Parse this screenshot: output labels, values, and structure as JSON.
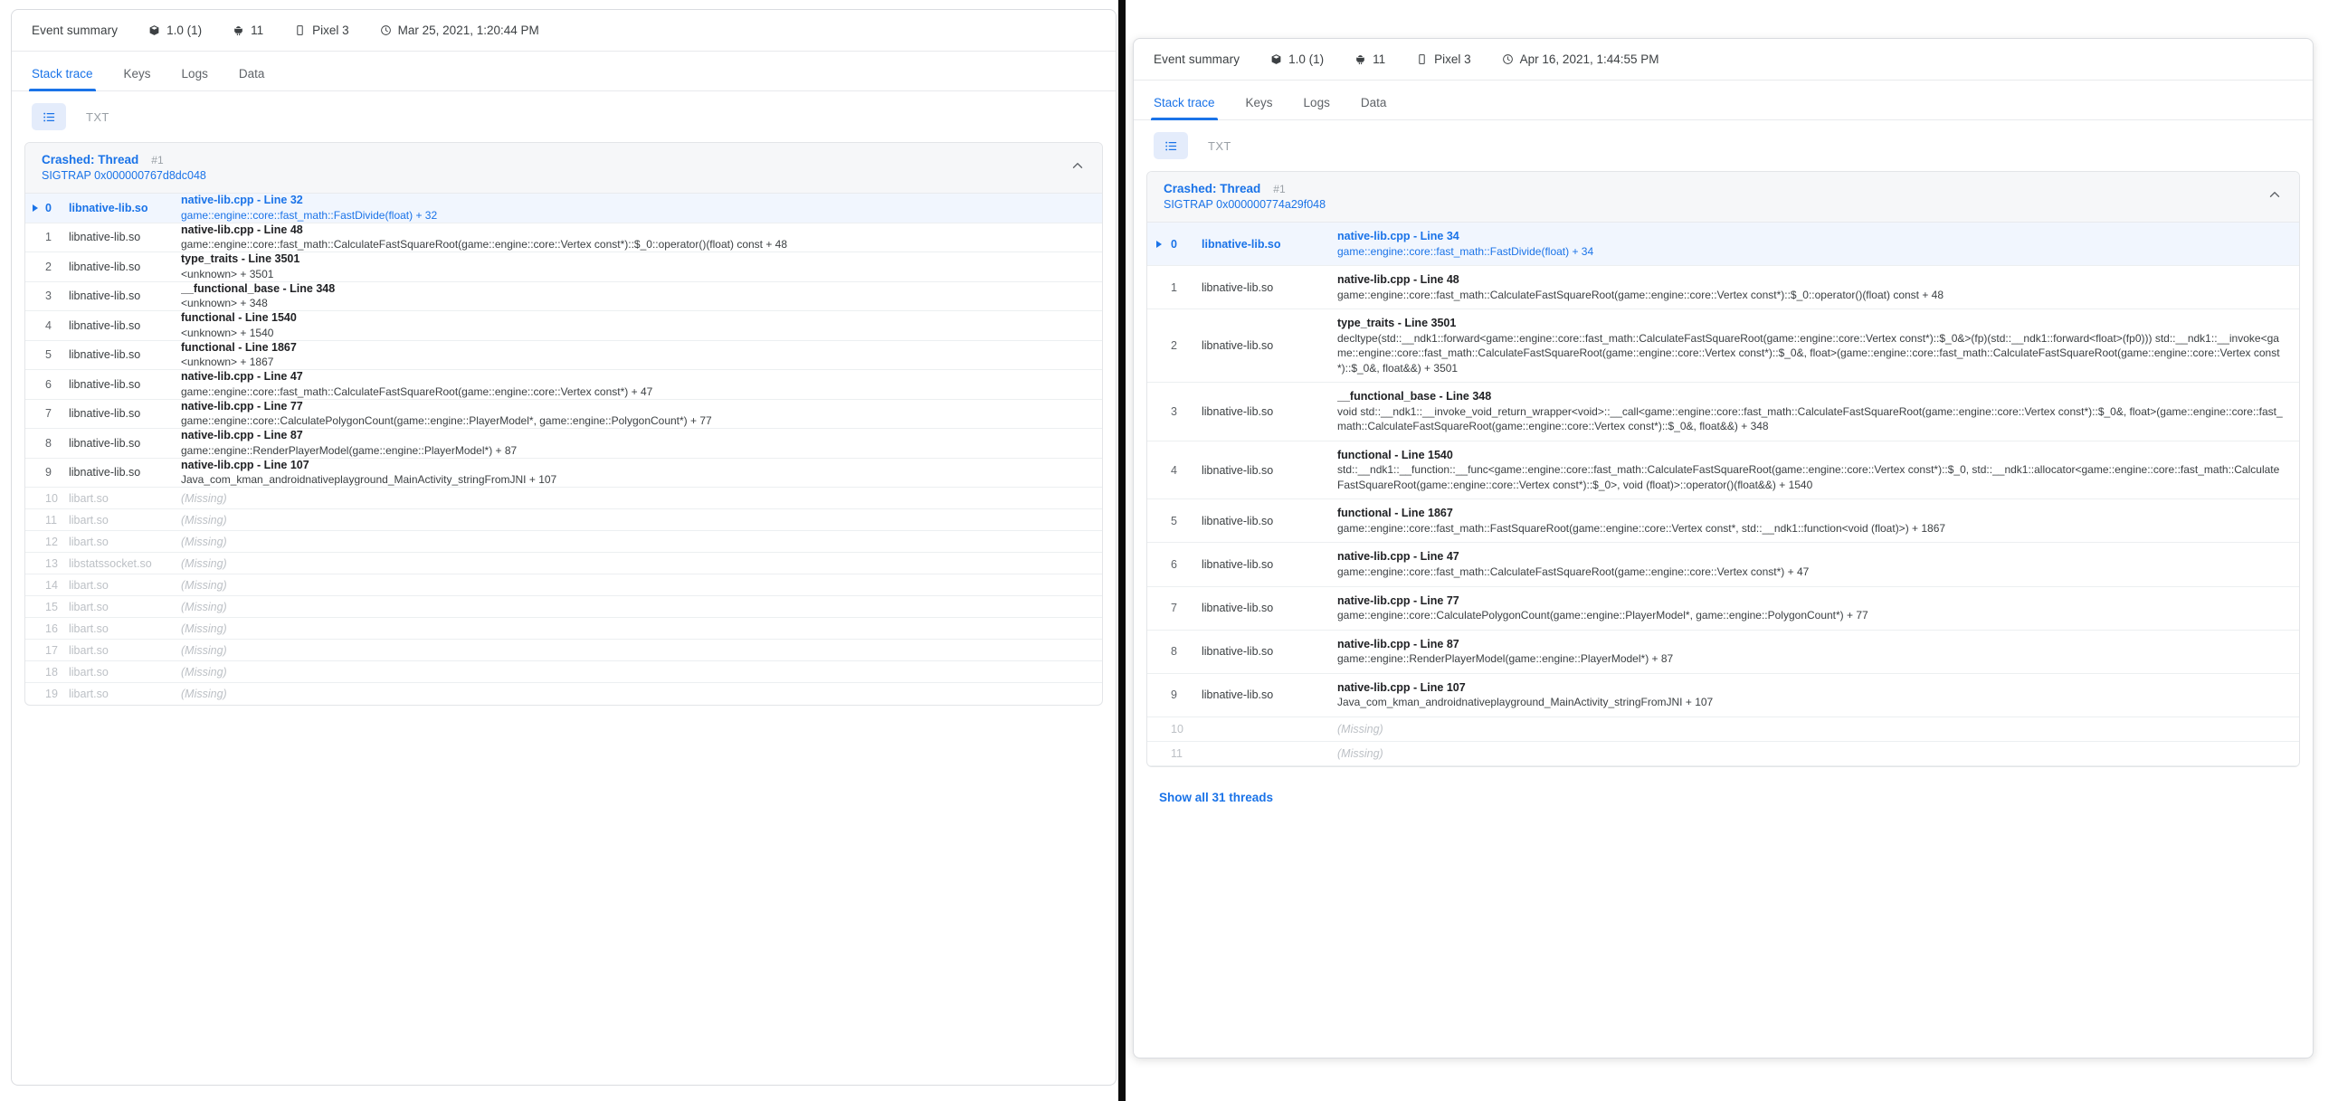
{
  "panels": {
    "left": {
      "summary": {
        "label": "Event summary",
        "version": "1.0 (1)",
        "api_level": "11",
        "device": "Pixel 3",
        "timestamp": "Mar 25, 2021, 1:20:44 PM"
      },
      "tabs": [
        {
          "label": "Stack trace",
          "active": true
        },
        {
          "label": "Keys",
          "active": false
        },
        {
          "label": "Logs",
          "active": false
        },
        {
          "label": "Data",
          "active": false
        }
      ],
      "view": {
        "list_icon": "list-view-icon",
        "txt_label": "TXT"
      },
      "thread": {
        "title": "Crashed: Thread",
        "number": "#1",
        "signal": "SIGTRAP 0x000000767d8dc048",
        "collapse_icon": "chevron-up-icon"
      },
      "frames": [
        {
          "index": "0",
          "lib": "libnative-lib.so",
          "line": "native-lib.cpp - Line 32",
          "symbol": "game::engine::core::fast_math::FastDivide(float) + 32",
          "crash": true,
          "missing": false
        },
        {
          "index": "1",
          "lib": "libnative-lib.so",
          "line": "native-lib.cpp - Line 48",
          "symbol": "game::engine::core::fast_math::CalculateFastSquareRoot(game::engine::core::Vertex const*)::$_0::operator()(float) const + 48",
          "crash": false,
          "missing": false
        },
        {
          "index": "2",
          "lib": "libnative-lib.so",
          "line": "type_traits - Line 3501",
          "symbol": "<unknown> + 3501",
          "crash": false,
          "missing": false
        },
        {
          "index": "3",
          "lib": "libnative-lib.so",
          "line": "__functional_base - Line 348",
          "symbol": "<unknown> + 348",
          "crash": false,
          "missing": false
        },
        {
          "index": "4",
          "lib": "libnative-lib.so",
          "line": "functional - Line 1540",
          "symbol": "<unknown> + 1540",
          "crash": false,
          "missing": false
        },
        {
          "index": "5",
          "lib": "libnative-lib.so",
          "line": "functional - Line 1867",
          "symbol": "<unknown> + 1867",
          "crash": false,
          "missing": false
        },
        {
          "index": "6",
          "lib": "libnative-lib.so",
          "line": "native-lib.cpp - Line 47",
          "symbol": "game::engine::core::fast_math::CalculateFastSquareRoot(game::engine::core::Vertex const*) + 47",
          "crash": false,
          "missing": false
        },
        {
          "index": "7",
          "lib": "libnative-lib.so",
          "line": "native-lib.cpp - Line 77",
          "symbol": "game::engine::core::CalculatePolygonCount(game::engine::PlayerModel*, game::engine::PolygonCount*) + 77",
          "crash": false,
          "missing": false
        },
        {
          "index": "8",
          "lib": "libnative-lib.so",
          "line": "native-lib.cpp - Line 87",
          "symbol": "game::engine::RenderPlayerModel(game::engine::PlayerModel*) + 87",
          "crash": false,
          "missing": false
        },
        {
          "index": "9",
          "lib": "libnative-lib.so",
          "line": "native-lib.cpp - Line 107",
          "symbol": "Java_com_kman_androidnativeplayground_MainActivity_stringFromJNI + 107",
          "crash": false,
          "missing": false
        },
        {
          "index": "10",
          "lib": "libart.so",
          "line": "",
          "symbol": "",
          "missing_label": "(Missing)",
          "crash": false,
          "missing": true
        },
        {
          "index": "11",
          "lib": "libart.so",
          "line": "",
          "symbol": "",
          "missing_label": "(Missing)",
          "crash": false,
          "missing": true
        },
        {
          "index": "12",
          "lib": "libart.so",
          "line": "",
          "symbol": "",
          "missing_label": "(Missing)",
          "crash": false,
          "missing": true
        },
        {
          "index": "13",
          "lib": "libstatssocket.so",
          "line": "",
          "symbol": "",
          "missing_label": "(Missing)",
          "crash": false,
          "missing": true
        },
        {
          "index": "14",
          "lib": "libart.so",
          "line": "",
          "symbol": "",
          "missing_label": "(Missing)",
          "crash": false,
          "missing": true
        },
        {
          "index": "15",
          "lib": "libart.so",
          "line": "",
          "symbol": "",
          "missing_label": "(Missing)",
          "crash": false,
          "missing": true
        },
        {
          "index": "16",
          "lib": "libart.so",
          "line": "",
          "symbol": "",
          "missing_label": "(Missing)",
          "crash": false,
          "missing": true
        },
        {
          "index": "17",
          "lib": "libart.so",
          "line": "",
          "symbol": "",
          "missing_label": "(Missing)",
          "crash": false,
          "missing": true
        },
        {
          "index": "18",
          "lib": "libart.so",
          "line": "",
          "symbol": "",
          "missing_label": "(Missing)",
          "crash": false,
          "missing": true
        },
        {
          "index": "19",
          "lib": "libart.so",
          "line": "",
          "symbol": "",
          "missing_label": "(Missing)",
          "crash": false,
          "missing": true
        }
      ]
    },
    "right": {
      "summary": {
        "label": "Event summary",
        "version": "1.0 (1)",
        "api_level": "11",
        "device": "Pixel 3",
        "timestamp": "Apr 16, 2021, 1:44:55 PM"
      },
      "tabs": [
        {
          "label": "Stack trace",
          "active": true
        },
        {
          "label": "Keys",
          "active": false
        },
        {
          "label": "Logs",
          "active": false
        },
        {
          "label": "Data",
          "active": false
        }
      ],
      "view": {
        "list_icon": "list-view-icon",
        "txt_label": "TXT"
      },
      "thread": {
        "title": "Crashed: Thread",
        "number": "#1",
        "signal": "SIGTRAP 0x000000774a29f048",
        "collapse_icon": "chevron-up-icon"
      },
      "frames": [
        {
          "index": "0",
          "lib": "libnative-lib.so",
          "line": "native-lib.cpp - Line 34",
          "symbol": "game::engine::core::fast_math::FastDivide(float) + 34",
          "crash": true,
          "missing": false
        },
        {
          "index": "1",
          "lib": "libnative-lib.so",
          "line": "native-lib.cpp - Line 48",
          "symbol": "game::engine::core::fast_math::CalculateFastSquareRoot(game::engine::core::Vertex const*)::$_0::operator()(float) const + 48",
          "crash": false,
          "missing": false
        },
        {
          "index": "2",
          "lib": "libnative-lib.so",
          "line": "type_traits - Line 3501",
          "symbol": "decltype(std::__ndk1::forward<game::engine::core::fast_math::CalculateFastSquareRoot(game::engine::core::Vertex const*)::$_0&>(fp)(std::__ndk1::forward<float>(fp0))) std::__ndk1::__invoke<game::engine::core::fast_math::CalculateFastSquareRoot(game::engine::core::Vertex const*)::$_0&, float>(game::engine::core::fast_math::CalculateFastSquareRoot(game::engine::core::Vertex const*)::$_0&, float&&) + 3501",
          "crash": false,
          "missing": false
        },
        {
          "index": "3",
          "lib": "libnative-lib.so",
          "line": "__functional_base - Line 348",
          "symbol": "void std::__ndk1::__invoke_void_return_wrapper<void>::__call<game::engine::core::fast_math::CalculateFastSquareRoot(game::engine::core::Vertex const*)::$_0&, float>(game::engine::core::fast_math::CalculateFastSquareRoot(game::engine::core::Vertex const*)::$_0&, float&&) + 348",
          "crash": false,
          "missing": false
        },
        {
          "index": "4",
          "lib": "libnative-lib.so",
          "line": "functional - Line 1540",
          "symbol": "std::__ndk1::__function::__func<game::engine::core::fast_math::CalculateFastSquareRoot(game::engine::core::Vertex const*)::$_0, std::__ndk1::allocator<game::engine::core::fast_math::CalculateFastSquareRoot(game::engine::core::Vertex const*)::$_0>, void (float)>::operator()(float&&) + 1540",
          "crash": false,
          "missing": false
        },
        {
          "index": "5",
          "lib": "libnative-lib.so",
          "line": "functional - Line 1867",
          "symbol": "game::engine::core::fast_math::FastSquareRoot(game::engine::core::Vertex const*, std::__ndk1::function<void (float)>) + 1867",
          "crash": false,
          "missing": false
        },
        {
          "index": "6",
          "lib": "libnative-lib.so",
          "line": "native-lib.cpp - Line 47",
          "symbol": "game::engine::core::fast_math::CalculateFastSquareRoot(game::engine::core::Vertex const*) + 47",
          "crash": false,
          "missing": false
        },
        {
          "index": "7",
          "lib": "libnative-lib.so",
          "line": "native-lib.cpp - Line 77",
          "symbol": "game::engine::core::CalculatePolygonCount(game::engine::PlayerModel*, game::engine::PolygonCount*) + 77",
          "crash": false,
          "missing": false
        },
        {
          "index": "8",
          "lib": "libnative-lib.so",
          "line": "native-lib.cpp - Line 87",
          "symbol": "game::engine::RenderPlayerModel(game::engine::PlayerModel*) + 87",
          "crash": false,
          "missing": false
        },
        {
          "index": "9",
          "lib": "libnative-lib.so",
          "line": "native-lib.cpp - Line 107",
          "symbol": "Java_com_kman_androidnativeplayground_MainActivity_stringFromJNI + 107",
          "crash": false,
          "missing": false
        },
        {
          "index": "10",
          "lib": "",
          "line": "",
          "symbol": "",
          "missing_label": "(Missing)",
          "crash": false,
          "missing": true
        },
        {
          "index": "11",
          "lib": "",
          "line": "",
          "symbol": "",
          "missing_label": "(Missing)",
          "crash": false,
          "missing": true
        }
      ],
      "scroll_handle_icon": "scroll-drag-handle-icon",
      "footer_link": "Show all 31 threads"
    }
  },
  "colors": {
    "accent": "#1a73e8",
    "text": "#3c4043",
    "muted": "#9aa0a6",
    "disabled": "#bdc1c6",
    "header_bg": "#f6f7f9",
    "toggle_bg": "#e4ecfb"
  }
}
